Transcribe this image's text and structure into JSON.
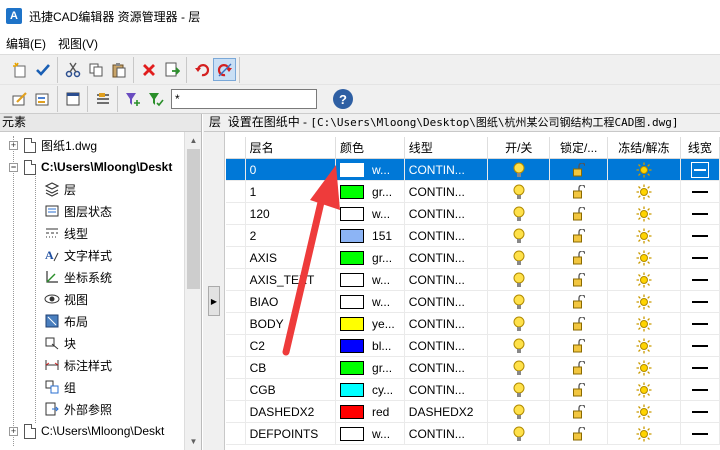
{
  "title": "迅捷CAD编辑器 资源管理器 - 层",
  "menu": [
    "编辑(E)",
    "视图(V)"
  ],
  "filter": {
    "value": "*"
  },
  "left_panel": {
    "header": "元素",
    "items": [
      {
        "label": "图纸1.dwg",
        "kind": "doc",
        "expander": "+"
      },
      {
        "label": "C:\\Users\\Mloong\\Deskt",
        "kind": "doc",
        "expander": "−",
        "bold": true
      },
      {
        "label": "层",
        "icon": "layers-icon"
      },
      {
        "label": "图层状态",
        "icon": "layer-state-icon"
      },
      {
        "label": "线型",
        "icon": "linetype-icon"
      },
      {
        "label": "文字样式",
        "icon": "text-style-icon"
      },
      {
        "label": "坐标系统",
        "icon": "coordinate-system-icon"
      },
      {
        "label": "视图",
        "icon": "eye-icon"
      },
      {
        "label": "布局",
        "icon": "layout-icon"
      },
      {
        "label": "块",
        "icon": "block-icon"
      },
      {
        "label": "标注样式",
        "icon": "dimension-style-icon"
      },
      {
        "label": "组",
        "icon": "group-icon"
      },
      {
        "label": "外部参照",
        "icon": "xref-icon"
      },
      {
        "label": "C:\\Users\\Mloong\\Deskt",
        "kind": "doc",
        "expander": "+"
      }
    ]
  },
  "right_panel": {
    "header_label": "层",
    "header_status": "设置在图纸中 - ",
    "header_path": "[C:\\Users\\Mloong\\Desktop\\图纸\\杭州某公司钢结构工程CAD图.dwg]",
    "columns": [
      "层名",
      "颜色",
      "线型",
      "开/关",
      "锁定/...",
      "冻结/解冻",
      "线宽"
    ],
    "rows": [
      {
        "name": "0",
        "color_hex": "#ffffff",
        "color": "w...",
        "linetype": "CONTIN...",
        "selected": true
      },
      {
        "name": "1",
        "color_hex": "#00ff00",
        "color": "gr...",
        "linetype": "CONTIN..."
      },
      {
        "name": "120",
        "color_hex": "#ffffff",
        "color": "w...",
        "linetype": "CONTIN..."
      },
      {
        "name": "2",
        "color_hex": "#8cb4f5",
        "color": "151",
        "linetype": "CONTIN..."
      },
      {
        "name": "AXIS",
        "color_hex": "#00ff00",
        "color": "gr...",
        "linetype": "CONTIN..."
      },
      {
        "name": "AXIS_TEXT",
        "color_hex": "#ffffff",
        "color": "w...",
        "linetype": "CONTIN..."
      },
      {
        "name": "BIAO",
        "color_hex": "#ffffff",
        "color": "w...",
        "linetype": "CONTIN..."
      },
      {
        "name": "BODY",
        "color_hex": "#ffff00",
        "color": "ye...",
        "linetype": "CONTIN..."
      },
      {
        "name": "C2",
        "color_hex": "#0000ff",
        "color": "bl...",
        "linetype": "CONTIN..."
      },
      {
        "name": "CB",
        "color_hex": "#00ff00",
        "color": "gr...",
        "linetype": "CONTIN..."
      },
      {
        "name": "CGB",
        "color_hex": "#00ffff",
        "color": "cy...",
        "linetype": "CONTIN..."
      },
      {
        "name": "DASHEDX2",
        "color_hex": "#ff0000",
        "color": "red",
        "linetype": "DASHEDX2"
      },
      {
        "name": "DEFPOINTS",
        "color_hex": "#ffffff",
        "color": "w...",
        "linetype": "CONTIN..."
      }
    ]
  },
  "colors": {
    "selection": "#0078d7",
    "annotation_arrow": "#ee3b3b"
  }
}
